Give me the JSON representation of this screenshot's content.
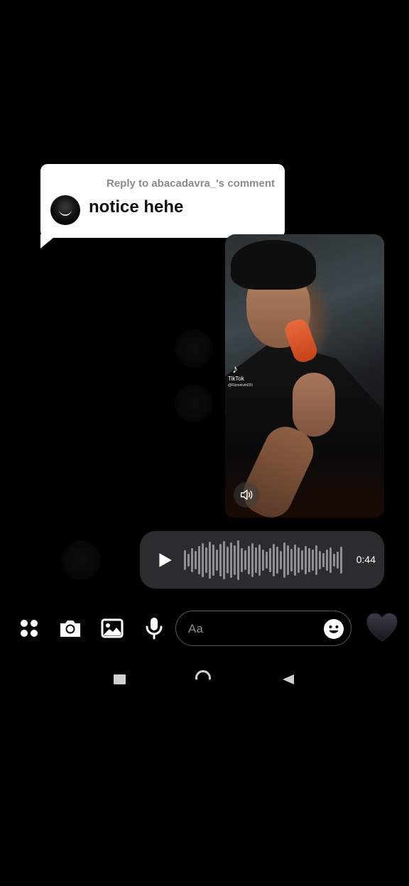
{
  "reply": {
    "title": "Reply to abacadavra_'s comment",
    "text": "notice hehe"
  },
  "video": {
    "watermark_brand": "TikTok",
    "watermark_handle": "@Rizmelvin025"
  },
  "voice_message": {
    "duration": "0:44"
  },
  "composer": {
    "placeholder": "Aa"
  },
  "colors": {
    "background": "#000000",
    "bubble": "#2c2c2e",
    "reply_card": "#ffffff",
    "muted_text": "#8a8a8f"
  },
  "icons": [
    "apps-grid-icon",
    "camera-icon",
    "image-icon",
    "microphone-icon",
    "emoji-icon",
    "heart-icon",
    "play-icon",
    "volume-icon",
    "recents-icon",
    "home-icon",
    "back-icon"
  ]
}
